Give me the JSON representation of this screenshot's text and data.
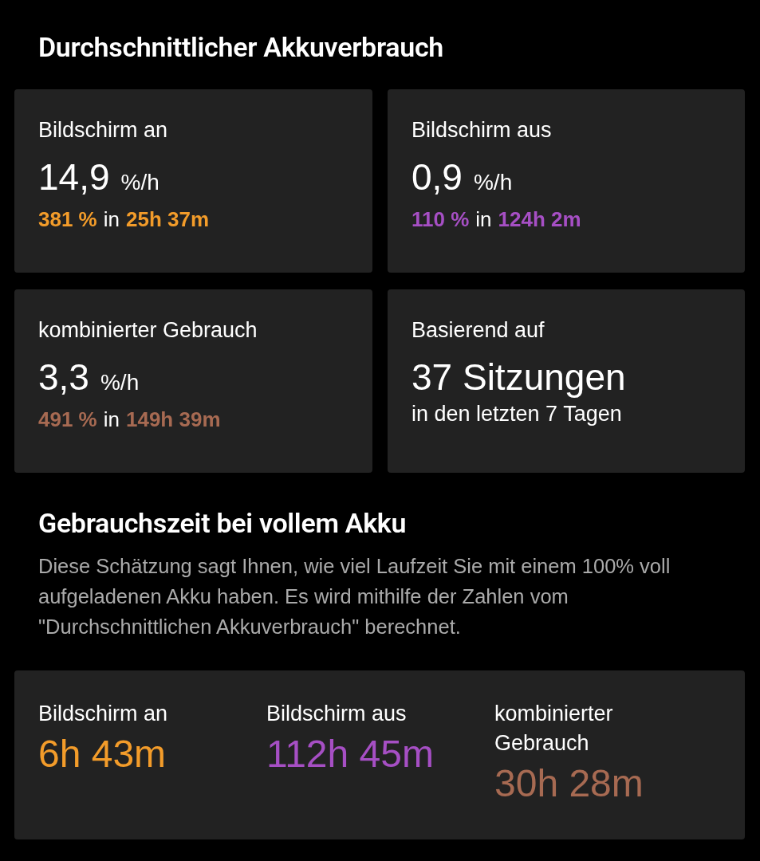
{
  "title": "Durchschnittlicher Akkuverbrauch",
  "usage_cards": [
    {
      "kind": "rate",
      "label": "Bildschirm an",
      "value": "14,9",
      "unit": "%/h",
      "percent": "381 %",
      "connector": "in",
      "duration": "25h 37m",
      "color": "#f39c2a"
    },
    {
      "kind": "rate",
      "label": "Bildschirm aus",
      "value": "0,9",
      "unit": "%/h",
      "percent": "110 %",
      "connector": "in",
      "duration": "124h 2m",
      "color": "#a64fc4"
    },
    {
      "kind": "rate",
      "label": "kombinierter Gebrauch",
      "value": "3,3",
      "unit": "%/h",
      "percent": "491 %",
      "connector": "in",
      "duration": "149h 39m",
      "color": "#a76a52"
    },
    {
      "kind": "sessions",
      "label": "Basierend auf",
      "value": "37 Sitzungen",
      "note": "in den letzten 7 Tagen"
    }
  ],
  "estimate": {
    "title": "Gebrauchszeit bei vollem Akku",
    "description": "Diese Schätzung sagt Ihnen, wie viel Laufzeit Sie mit einem 100% voll aufgeladenen Akku haben. Es wird mithilfe der Zahlen vom \"Durchschnittlichen Akkuverbrauch\" berechnet.",
    "items": [
      {
        "label": "Bildschirm an",
        "value": "6h 43m",
        "color": "#f39c2a"
      },
      {
        "label": "Bildschirm aus",
        "value": "112h 45m",
        "color": "#a64fc4"
      },
      {
        "label": "kombinierter Gebrauch",
        "value": "30h 28m",
        "color": "#a76a52"
      }
    ]
  }
}
